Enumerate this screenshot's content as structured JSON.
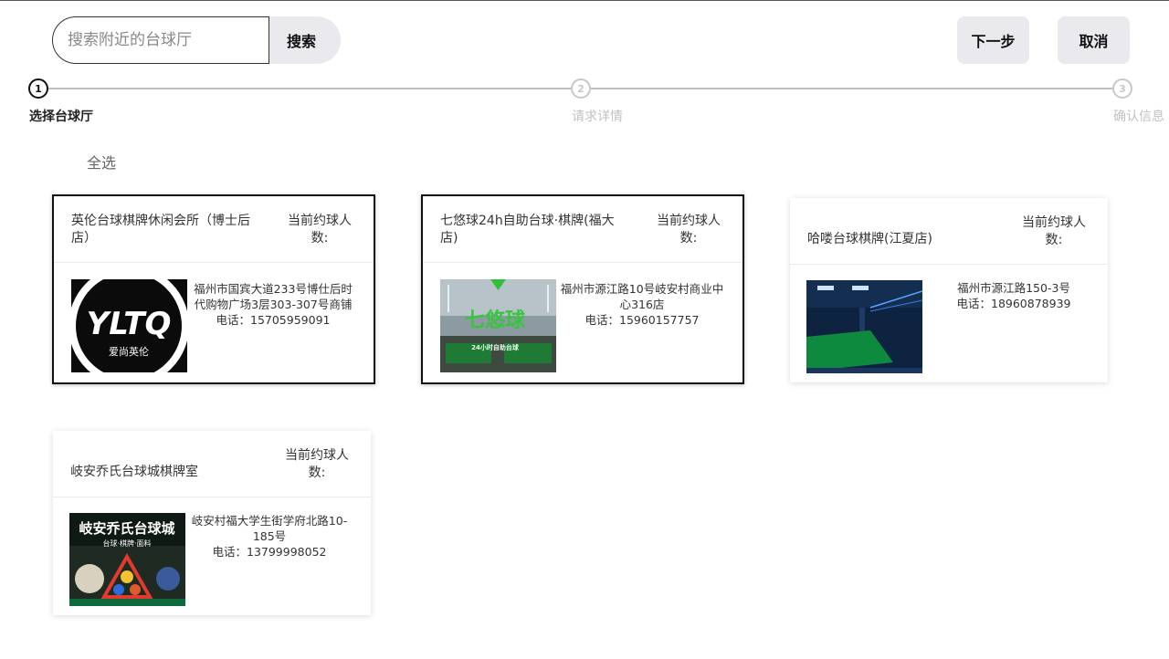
{
  "search": {
    "placeholder": "搜索附近的台球厅",
    "button_label": "搜索"
  },
  "actions": {
    "next_label": "下一步",
    "cancel_label": "取消"
  },
  "steps": [
    {
      "number": "1",
      "label": "选择台球厅"
    },
    {
      "number": "2",
      "label": "请求详情"
    },
    {
      "number": "3",
      "label": "确认信息"
    }
  ],
  "select_all_label": "全选",
  "venues": [
    {
      "name": "英伦台球棋牌休闲会所（博士后店）",
      "count_label": "当前约球人数:",
      "address": "福州市国宾大道233号博仕后时代购物广场3层303-307号商铺",
      "phone": "电话：15705959091",
      "image_text": "YLTQ",
      "image_subtext": "爱尚英伦"
    },
    {
      "name": "七悠球24h自助台球·棋牌(福大店)",
      "count_label": "当前约球人数:",
      "address": "福州市源江路10号岐安村商业中心316店",
      "phone": "电话：15960157757",
      "image_text": "七悠球",
      "image_subtext": "24小时自助台球"
    },
    {
      "name": "哈喽台球棋牌(江夏店)",
      "count_label": "当前约球人数:",
      "address": "福州市源江路150-3号",
      "phone": "电话：18960878939"
    },
    {
      "name": "岐安乔氏台球城棋牌室",
      "count_label": "当前约球人数:",
      "address": "岐安村福大学生街学府北路10-185号",
      "phone": "电话：13799998052",
      "image_text": "岐安乔氏台球城",
      "image_subtext": "台球·棋牌·面料"
    }
  ]
}
